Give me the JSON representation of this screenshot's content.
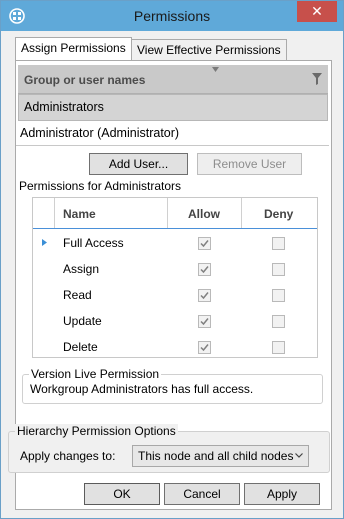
{
  "window": {
    "title": "Permissions",
    "close_glyph": "✕",
    "accent_color": "#5fa9d9"
  },
  "tabs": [
    {
      "label": "Assign Permissions",
      "active": true
    },
    {
      "label": "View Effective Permissions",
      "active": false
    }
  ],
  "group_list": {
    "header": "Group or user names",
    "items": [
      {
        "label": "Administrators",
        "selected": true
      },
      {
        "label": "Administrator (Administrator)",
        "selected": false
      }
    ]
  },
  "buttons": {
    "add_user": "Add User...",
    "remove_user": "Remove User"
  },
  "permissions": {
    "label": "Permissions for Administrators",
    "columns": {
      "name": "Name",
      "allow": "Allow",
      "deny": "Deny"
    },
    "rows": [
      {
        "name": "Full Access",
        "allow": true,
        "deny": false,
        "current": true
      },
      {
        "name": "Assign",
        "allow": true,
        "deny": false
      },
      {
        "name": "Read",
        "allow": true,
        "deny": false
      },
      {
        "name": "Update",
        "allow": true,
        "deny": false
      },
      {
        "name": "Delete",
        "allow": true,
        "deny": false
      }
    ]
  },
  "version_live": {
    "legend": "Version Live Permission",
    "text": "Workgroup Administrators has full access."
  },
  "hierarchy": {
    "legend": "Hierarchy Permission Options",
    "apply_label": "Apply changes to:",
    "apply_value": "This node and all child nodes"
  },
  "footer": {
    "ok": "OK",
    "cancel": "Cancel",
    "apply": "Apply"
  }
}
